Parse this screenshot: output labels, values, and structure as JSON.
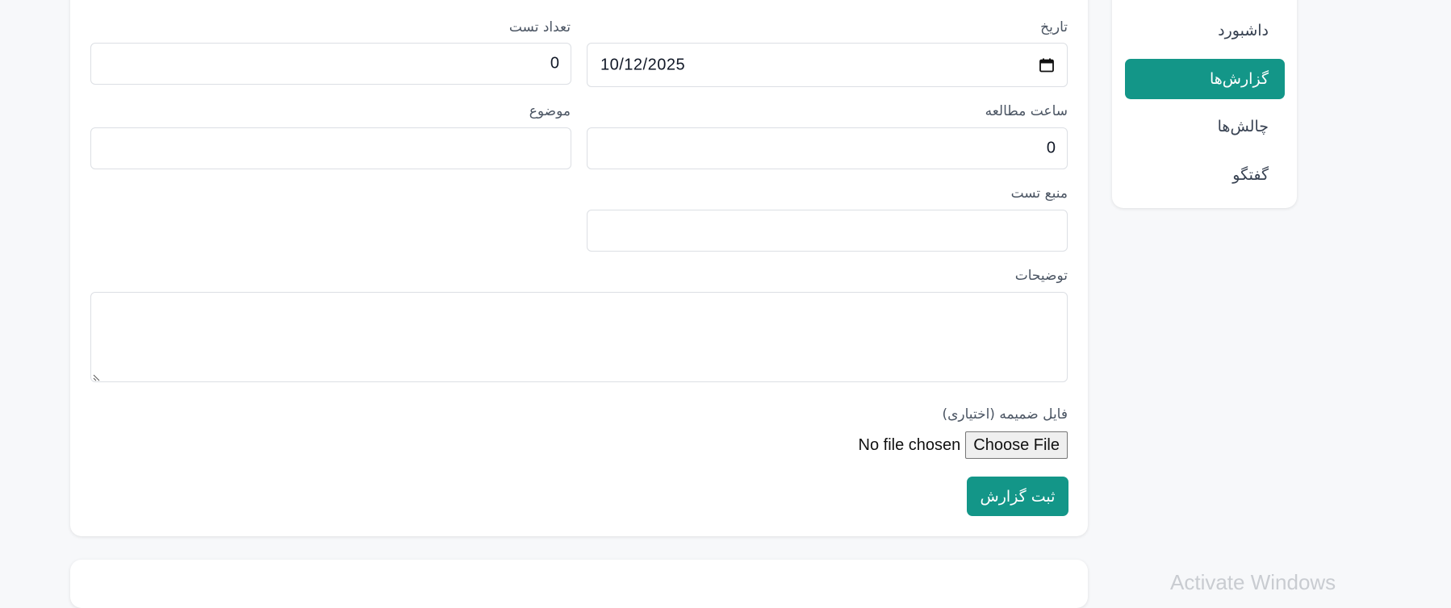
{
  "sidebar": {
    "items": [
      {
        "label": "داشبورد",
        "active": false
      },
      {
        "label": "گزارش‌ها",
        "active": true
      },
      {
        "label": "چالش‌ها",
        "active": false
      },
      {
        "label": "گفتگو",
        "active": false
      }
    ]
  },
  "form": {
    "date": {
      "label": "تاریخ",
      "value": "10/12/2025"
    },
    "test_count": {
      "label": "تعداد تست",
      "value": "0"
    },
    "study_hours": {
      "label": "ساعت مطالعه",
      "value": "0"
    },
    "subject": {
      "label": "موضوع",
      "value": ""
    },
    "test_source": {
      "label": "منبع تست",
      "value": ""
    },
    "description": {
      "label": "توضیحات",
      "value": ""
    },
    "attachment": {
      "label": "فایل ضمیمه (اختیاری)",
      "status": "No file chosen",
      "button": "Choose File"
    },
    "submit_label": "ثبت گزارش"
  },
  "os": {
    "watermark": "Activate Windows"
  },
  "colors": {
    "accent": "#139688"
  },
  "icons": {
    "date": "calendar-icon"
  }
}
